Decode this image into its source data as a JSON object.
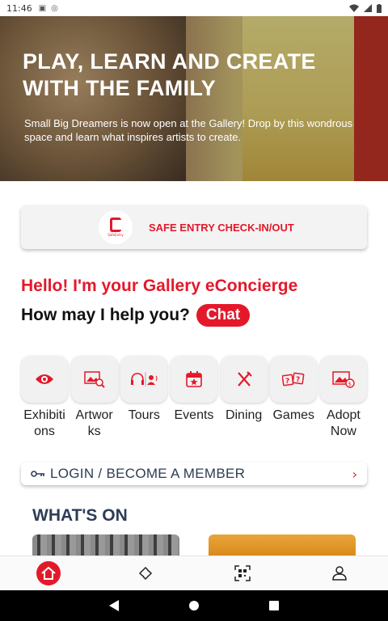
{
  "status_bar": {
    "time": "11:46"
  },
  "hero": {
    "title": "PLAY, LEARN AND CREATE WITH THE FAMILY",
    "description": "Small Big Dreamers is now open at the Gallery! Drop by this wondrous space and learn what inspires artists to create.",
    "slides": 6,
    "active_slide": 3
  },
  "safe_entry": {
    "label": "SAFE ENTRY CHECK-IN/OUT",
    "logo_text": "SafeEntry"
  },
  "concierge": {
    "greeting": "Hello! I'm your Gallery eConcierge",
    "question": "How may I help you?",
    "chat_label": "Chat"
  },
  "categories": [
    {
      "label": "Exhibitions",
      "display": "Exhibiti\nons",
      "icon": "eye-icon"
    },
    {
      "label": "Artworks",
      "display": "Artwor\nks",
      "icon": "image-search-icon"
    },
    {
      "label": "Tours",
      "display": "Tours",
      "icon": "headphones-icon"
    },
    {
      "label": "Events",
      "display": "Events",
      "icon": "calendar-icon"
    },
    {
      "label": "Dining",
      "display": "Dining",
      "icon": "cutlery-icon"
    },
    {
      "label": "Games",
      "display": "Games",
      "icon": "question-cards-icon"
    },
    {
      "label": "Adopt Now",
      "display": "Adopt\nNow",
      "icon": "adopt-artwork-icon"
    }
  ],
  "login": {
    "label": "LOGIN / BECOME A MEMBER"
  },
  "whats_on": {
    "title": "WHAT'S ON"
  },
  "tabbar": {
    "items": [
      "home-icon",
      "ticket-icon",
      "qr-code-icon",
      "profile-icon"
    ]
  },
  "colors": {
    "accent": "#e3192b",
    "navy": "#2e3d55"
  }
}
